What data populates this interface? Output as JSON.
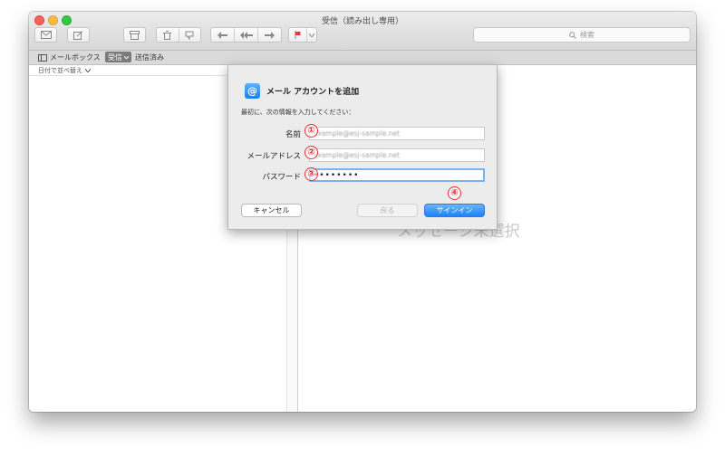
{
  "window": {
    "title": "受信（読み出し専用）"
  },
  "toolbar": {
    "search_placeholder": "検索",
    "search_icon": "magnifier-icon",
    "icons": [
      "compose-icon",
      "new-note-icon",
      "archive-icon",
      "trash-icon",
      "junk-icon",
      "reply-icon",
      "reply-all-icon",
      "forward-icon",
      "flag-icon"
    ]
  },
  "favorites": {
    "mailbox_label": "メールボックス",
    "inbox_label": "受信",
    "sent_label": "送信済み"
  },
  "list": {
    "sort_label": "日付で並べ替え"
  },
  "viewer": {
    "empty_text": "メッセージ未選択"
  },
  "dialog": {
    "title": "メール アカウントを追加",
    "intro": "最初に、次の情報を入力してください：",
    "fields": [
      {
        "label": "名前",
        "value": "example@esj-sample.net"
      },
      {
        "label": "メールアドレス",
        "value": "example@esj-sample.net"
      },
      {
        "label": "パスワード",
        "value": "••••••••"
      }
    ],
    "buttons": {
      "cancel": "キャンセル",
      "back": "戻る",
      "signin": "サインイン"
    },
    "markers": [
      "①",
      "②",
      "③",
      "④"
    ]
  },
  "colors": {
    "accent": "#1a82fb",
    "marker": "#e03030"
  }
}
